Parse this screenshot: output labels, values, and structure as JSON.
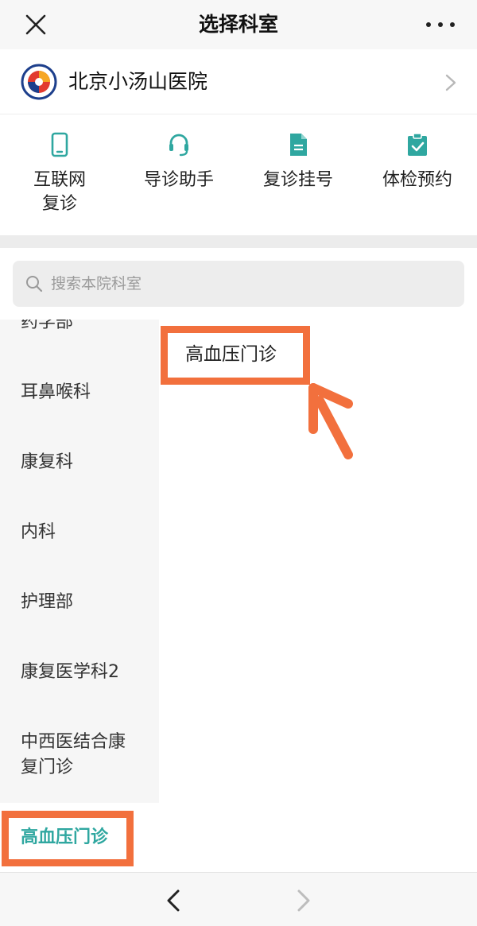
{
  "nav": {
    "title": "选择科室",
    "close_icon": "close-icon",
    "more_icon": "more-dots-icon"
  },
  "hospital": {
    "name": "北京小汤山医院",
    "logo_icon": "hospital-logo-icon",
    "chevron_icon": "chevron-right-icon"
  },
  "quick_actions": [
    {
      "icon": "phone-icon",
      "label_line1": "互联网",
      "label_line2": "复诊"
    },
    {
      "icon": "headset-icon",
      "label_line1": "导诊助手",
      "label_line2": ""
    },
    {
      "icon": "document-icon",
      "label_line1": "复诊挂号",
      "label_line2": ""
    },
    {
      "icon": "clipboard-check-icon",
      "label_line1": "体检预约",
      "label_line2": ""
    }
  ],
  "search": {
    "placeholder": "搜索本院科室",
    "icon": "search-icon"
  },
  "categories": [
    {
      "label": "药学部"
    },
    {
      "label": "耳鼻喉科"
    },
    {
      "label": "康复科"
    },
    {
      "label": "内科"
    },
    {
      "label": "护理部"
    },
    {
      "label": "康复医学科2"
    },
    {
      "label_line1": "中西医结合康",
      "label_line2": "复门诊"
    },
    {
      "label": "高血压门诊",
      "selected": true
    }
  ],
  "departments": [
    {
      "label": "高血压门诊"
    }
  ],
  "colors": {
    "accent": "#2fa7a0",
    "highlight": "#f2703d",
    "separator": "#ececec"
  },
  "bottom_bar": {
    "back_icon": "chevron-left-icon",
    "forward_icon": "chevron-right-icon"
  }
}
